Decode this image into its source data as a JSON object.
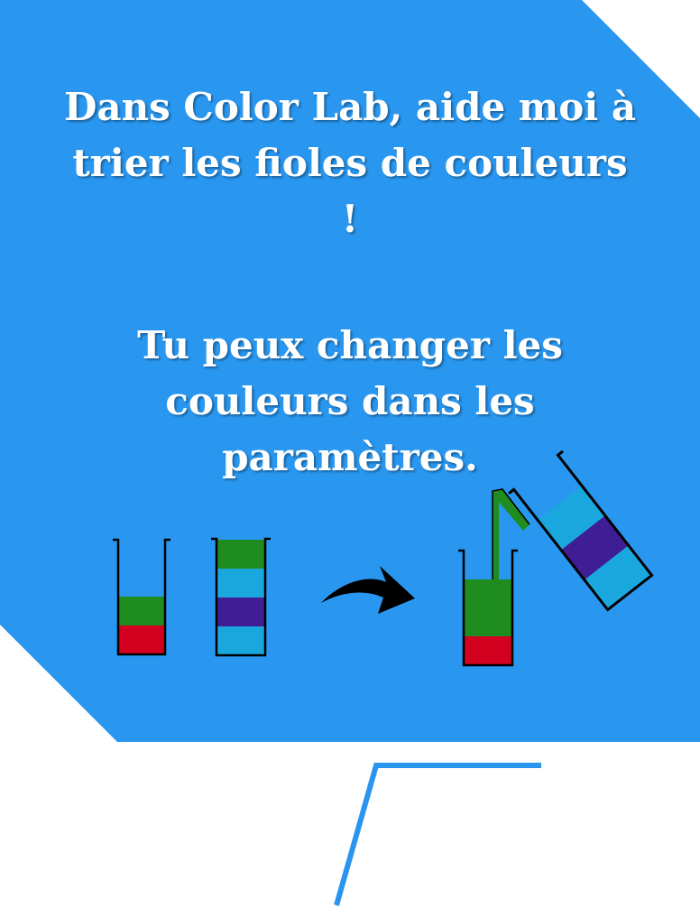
{
  "tutorial": {
    "message_1": "Dans Color Lab, aide moi à trier les fioles de couleurs !",
    "message_2": "Tu peux changer les couleurs dans les paramètres."
  },
  "colors": {
    "panel": "#2997f0",
    "pointer": "#2a95ee",
    "text": "#ffffff",
    "green": "#1f8c1f",
    "red": "#d40020",
    "light_blue": "#1aa7dd",
    "purple": "#3f1d94",
    "arrow": "#000000",
    "outline": "#000000"
  },
  "icons": [
    "curved-arrow-icon"
  ],
  "vials": [
    {
      "name": "vial-left",
      "layers_bottom_to_top": [
        "red",
        "green"
      ],
      "capacity": 4
    },
    {
      "name": "vial-middle",
      "layers_bottom_to_top": [
        "light_blue",
        "purple",
        "light_blue",
        "green"
      ],
      "capacity": 4
    },
    {
      "name": "vial-target",
      "layers_bottom_to_top": [
        "red",
        "green",
        "green"
      ],
      "capacity": 4
    },
    {
      "name": "vial-pouring",
      "layers_bottom_to_top": [
        "light_blue",
        "purple",
        "light_blue"
      ],
      "capacity": 4
    }
  ]
}
